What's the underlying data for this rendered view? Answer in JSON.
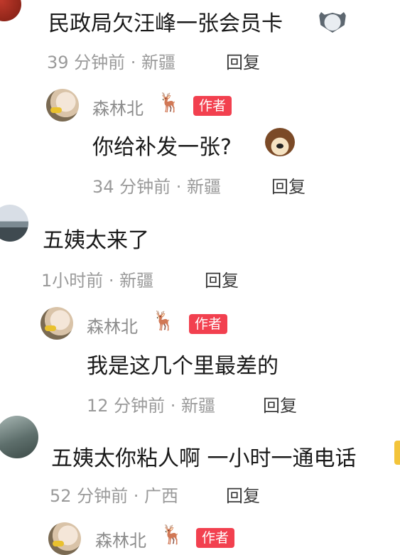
{
  "comments": [
    {
      "text": "民政局欠汪峰一张会员卡",
      "meta": "39 分钟前 · 新疆",
      "reply_label": "回复",
      "emoji": "wolf-face-icon",
      "reply": {
        "author": "森林北",
        "author_icon": "deer-icon",
        "tag": "作者",
        "text": "你给补发一张?",
        "emoji": "dog-face-icon",
        "meta": "34 分钟前 · 新疆",
        "reply_label": "回复"
      }
    },
    {
      "text": "五姨太来了",
      "meta": "1小时前 · 新疆",
      "reply_label": "回复",
      "reply": {
        "author": "森林北",
        "author_icon": "deer-icon",
        "tag": "作者",
        "text": "我是这几个里最差的",
        "meta": "12 分钟前 · 新疆",
        "reply_label": "回复"
      }
    },
    {
      "text": "五姨太你粘人啊 一小时一通电话",
      "meta": "52 分钟前 · 广西",
      "reply_label": "回复",
      "reply": {
        "author": "森林北",
        "author_icon": "deer-icon",
        "tag": "作者"
      }
    }
  ],
  "colors": {
    "tag_bg": "#f2404f",
    "meta_text": "#9a9a9a",
    "comment_text": "#1a1a1a"
  }
}
